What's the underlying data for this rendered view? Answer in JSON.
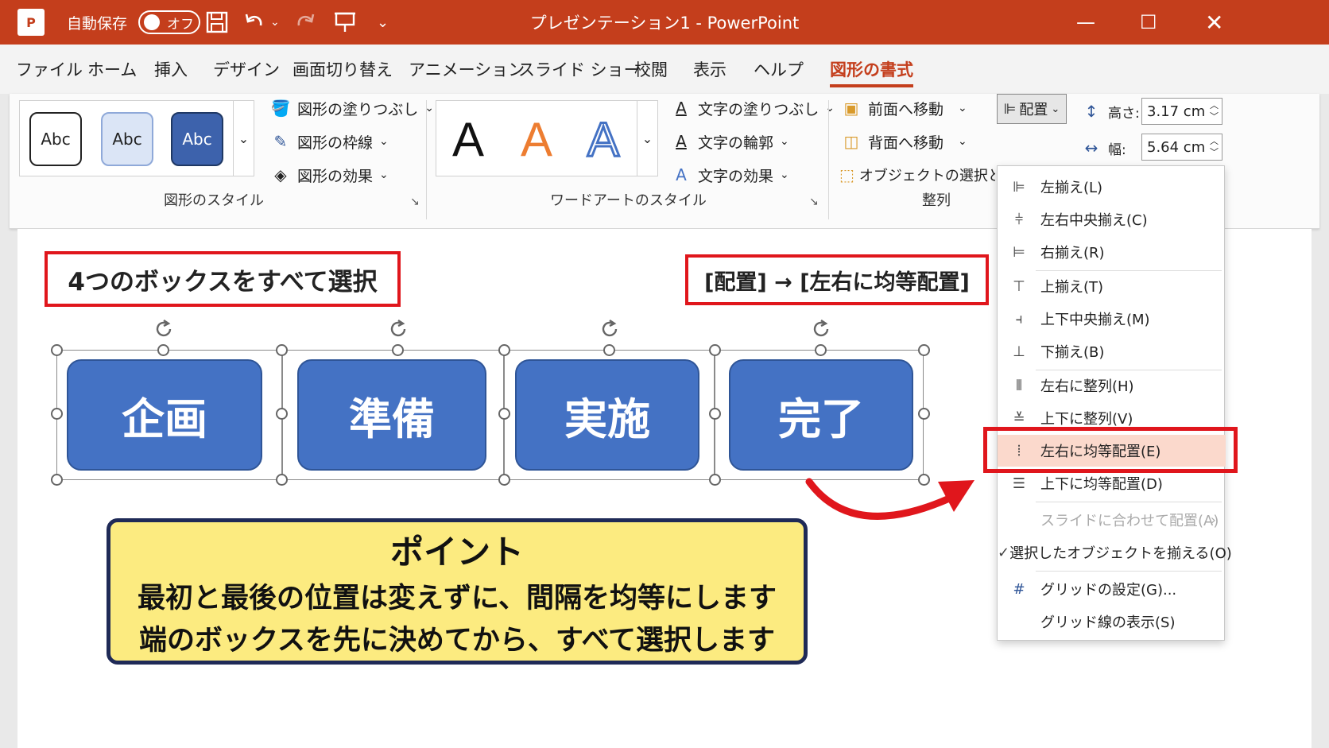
{
  "app": {
    "logo": "P",
    "autosave_label": "自動保存",
    "autosave_state": "オフ",
    "window_title": "プレゼンテーション1  -  PowerPoint"
  },
  "tabs": [
    "ファイル",
    "ホーム",
    "挿入",
    "デザイン",
    "画面切り替え",
    "アニメーション",
    "スライド ショー",
    "校閲",
    "表示",
    "ヘルプ",
    "図形の書式"
  ],
  "ribbon": {
    "shape_styles": {
      "samples": [
        "Abc",
        "Abc",
        "Abc"
      ],
      "fill": "図形の塗りつぶし",
      "outline": "図形の枠線",
      "effects": "図形の効果",
      "group_label": "図形のスタイル"
    },
    "wordart": {
      "samples": [
        "A",
        "A",
        "A"
      ],
      "text_fill": "文字の塗りつぶし",
      "text_outline": "文字の輪郭",
      "text_effects": "文字の効果",
      "group_label": "ワードアートのスタイル"
    },
    "arrange": {
      "bring_forward": "前面へ移動",
      "send_backward": "背面へ移動",
      "selection_pane": "オブジェクトの選択と表示",
      "group_label": "整列",
      "align_button": "配置"
    },
    "size": {
      "height_label": "高さ:",
      "height_value": "3.17 cm",
      "width_label": "幅:",
      "width_value": "5.64 cm"
    }
  },
  "slide": {
    "callout_left": "4つのボックスをすべて選択",
    "callout_right": "[配置] → [左右に均等配置]",
    "boxes": [
      "企画",
      "準備",
      "実施",
      "完了"
    ],
    "point_title": "ポイント",
    "point_line1": "最初と最後の位置は変えずに、間隔を均等にします",
    "point_line2": "端のボックスを先に決めてから、すべて選択します"
  },
  "align_menu": {
    "items": [
      {
        "label": "左揃え(L)",
        "icon": "align-left-icon"
      },
      {
        "label": "左右中央揃え(C)",
        "icon": "align-center-icon"
      },
      {
        "label": "右揃え(R)",
        "icon": "align-right-icon"
      },
      {
        "label": "上揃え(T)",
        "icon": "align-top-icon"
      },
      {
        "label": "上下中央揃え(M)",
        "icon": "align-middle-icon"
      },
      {
        "label": "下揃え(B)",
        "icon": "align-bottom-icon"
      },
      {
        "label": "左右に整列(H)",
        "icon": "arrange-horizontal-icon"
      },
      {
        "label": "上下に整列(V)",
        "icon": "arrange-vertical-icon"
      },
      {
        "label": "左右に均等配置(E)",
        "icon": "distribute-horizontal-icon",
        "highlighted": true
      },
      {
        "label": "上下に均等配置(D)",
        "icon": "distribute-vertical-icon"
      },
      {
        "label": "スライドに合わせて配置(A)",
        "icon": "",
        "disabled": true
      },
      {
        "label": "選択したオブジェクトを揃える(O)",
        "icon": "checkmark-icon"
      },
      {
        "label": "グリッドの設定(G)...",
        "icon": "grid-icon"
      },
      {
        "label": "グリッド線の表示(S)",
        "icon": ""
      }
    ]
  },
  "colors": {
    "title_bar": "#c43e1c",
    "accent_red": "#e0161c",
    "box_blue": "#4472c4",
    "point_fill": "#fceb80",
    "point_border": "#1f2a57",
    "menu_highlight": "#fbd9cc"
  }
}
